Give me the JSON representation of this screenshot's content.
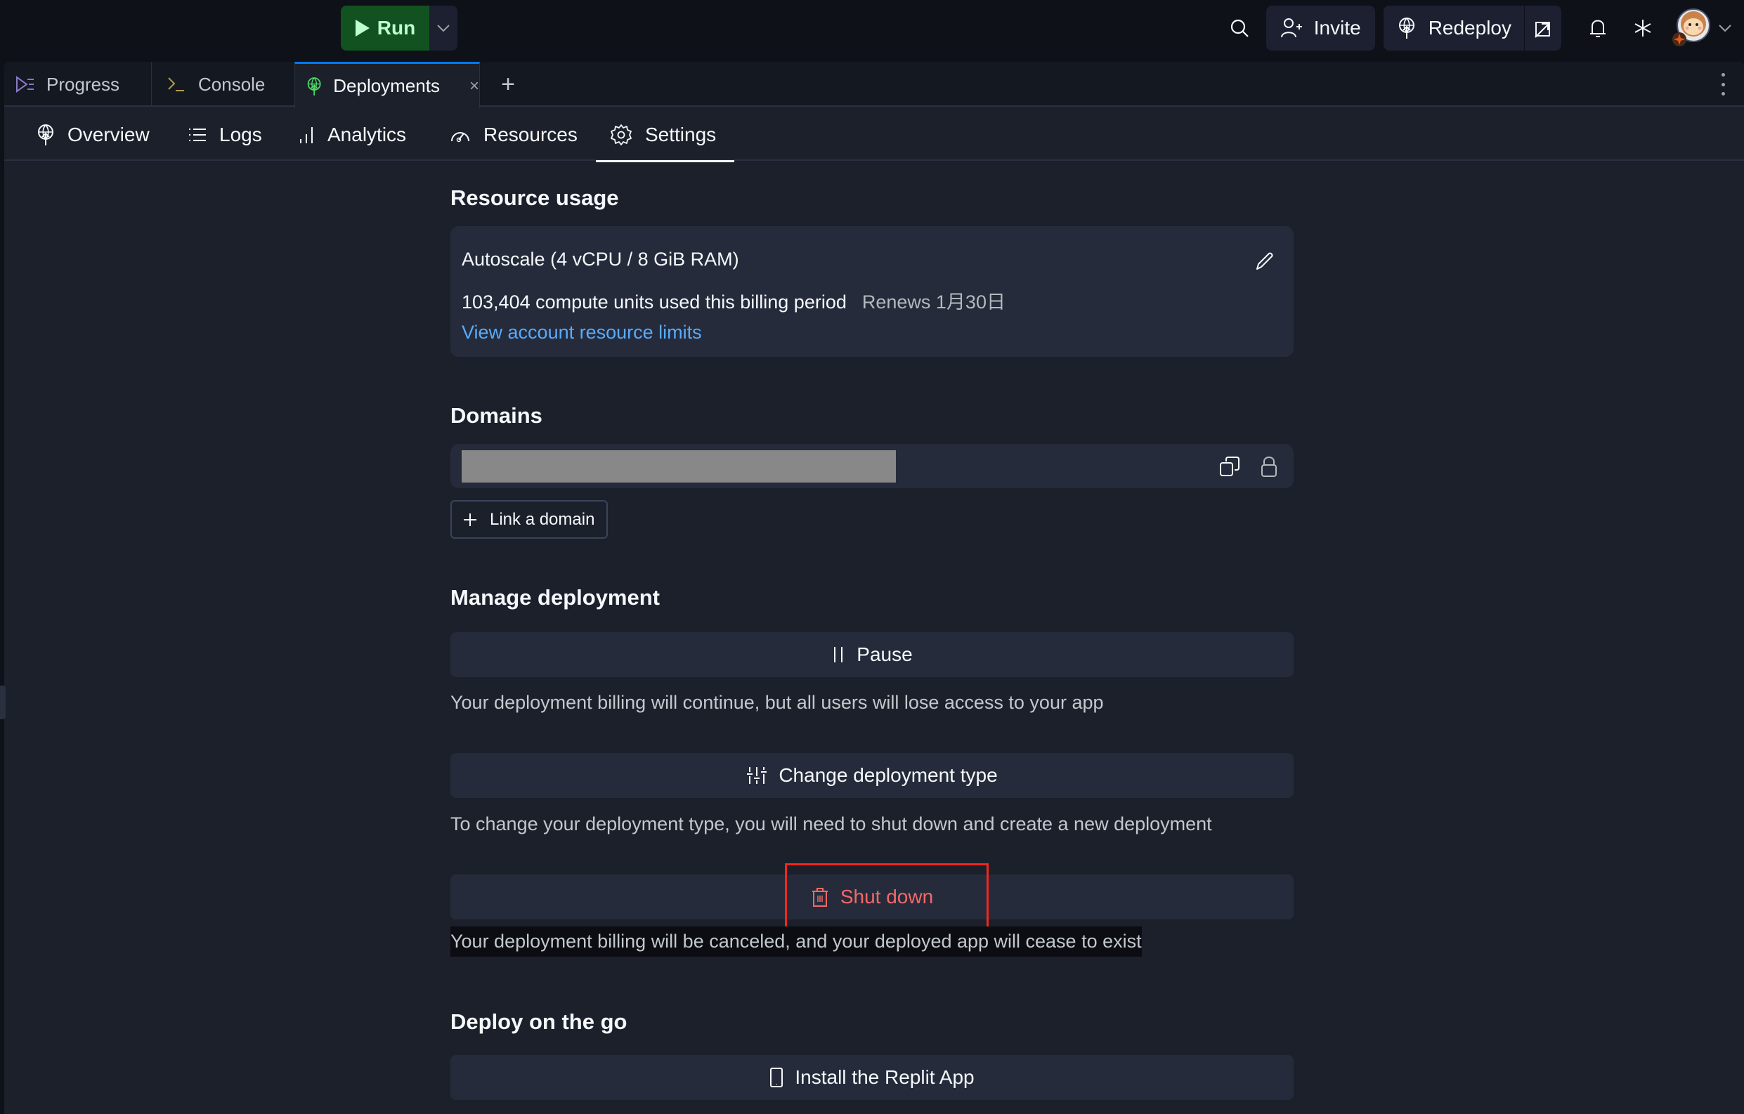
{
  "topbar": {
    "run_label": "Run",
    "run_icon": "play-icon",
    "run_caret_icon": "chevron-down-icon",
    "search_icon": "search-icon",
    "invite_label": "Invite",
    "invite_icon": "user-plus-icon",
    "redeploy_label": "Redeploy",
    "redeploy_icon": "globe-upload-icon",
    "open_icon": "external-link-icon",
    "bell_icon": "bell-icon",
    "asterisk_icon": "asterisk-icon",
    "avatar_icon": "avatar-monkey",
    "avatar_caret_icon": "chevron-down-icon"
  },
  "tabs": [
    {
      "label": "Progress",
      "icon": "progress-icon",
      "active": false
    },
    {
      "label": "Console",
      "icon": "terminal-icon",
      "active": false
    },
    {
      "label": "Deployments",
      "icon": "globe-upload-icon",
      "active": true,
      "closable": true
    }
  ],
  "tab_add_label": "+",
  "tab_close_label": "×",
  "subtabs": [
    {
      "label": "Overview",
      "icon": "globe-upload-icon"
    },
    {
      "label": "Logs",
      "icon": "list-icon"
    },
    {
      "label": "Analytics",
      "icon": "bar-chart-icon"
    },
    {
      "label": "Resources",
      "icon": "gauge-icon"
    },
    {
      "label": "Settings",
      "icon": "gear-icon",
      "active": true
    }
  ],
  "resource_usage": {
    "heading": "Resource usage",
    "machine": "Autoscale (4 vCPU / 8 GiB RAM)",
    "usage": "103,404 compute units used this billing period",
    "renews": "Renews 1月30日",
    "limits_link": "View account resource limits"
  },
  "domains": {
    "heading": "Domains",
    "domain_value": "[redacted]",
    "link_domain_label": "Link a domain"
  },
  "manage": {
    "heading": "Manage deployment",
    "pause_label": "Pause",
    "pause_desc": "Your deployment billing will continue, but all users will lose access to your app",
    "change_label": "Change deployment type",
    "change_desc": "To change your deployment type, you will need to shut down and create a new deployment",
    "shutdown_label": "Shut down",
    "shutdown_desc": "Your deployment billing will be canceled, and your deployed app will cease to exist"
  },
  "go": {
    "heading": "Deploy on the go",
    "install_label": "Install the Replit App"
  },
  "colors": {
    "run_bg": "#125220",
    "run_fg": "#bfffcf",
    "accent_blue": "#0079f2",
    "link": "#57abff",
    "danger": "#f26969",
    "annotation": "#f0281e"
  }
}
